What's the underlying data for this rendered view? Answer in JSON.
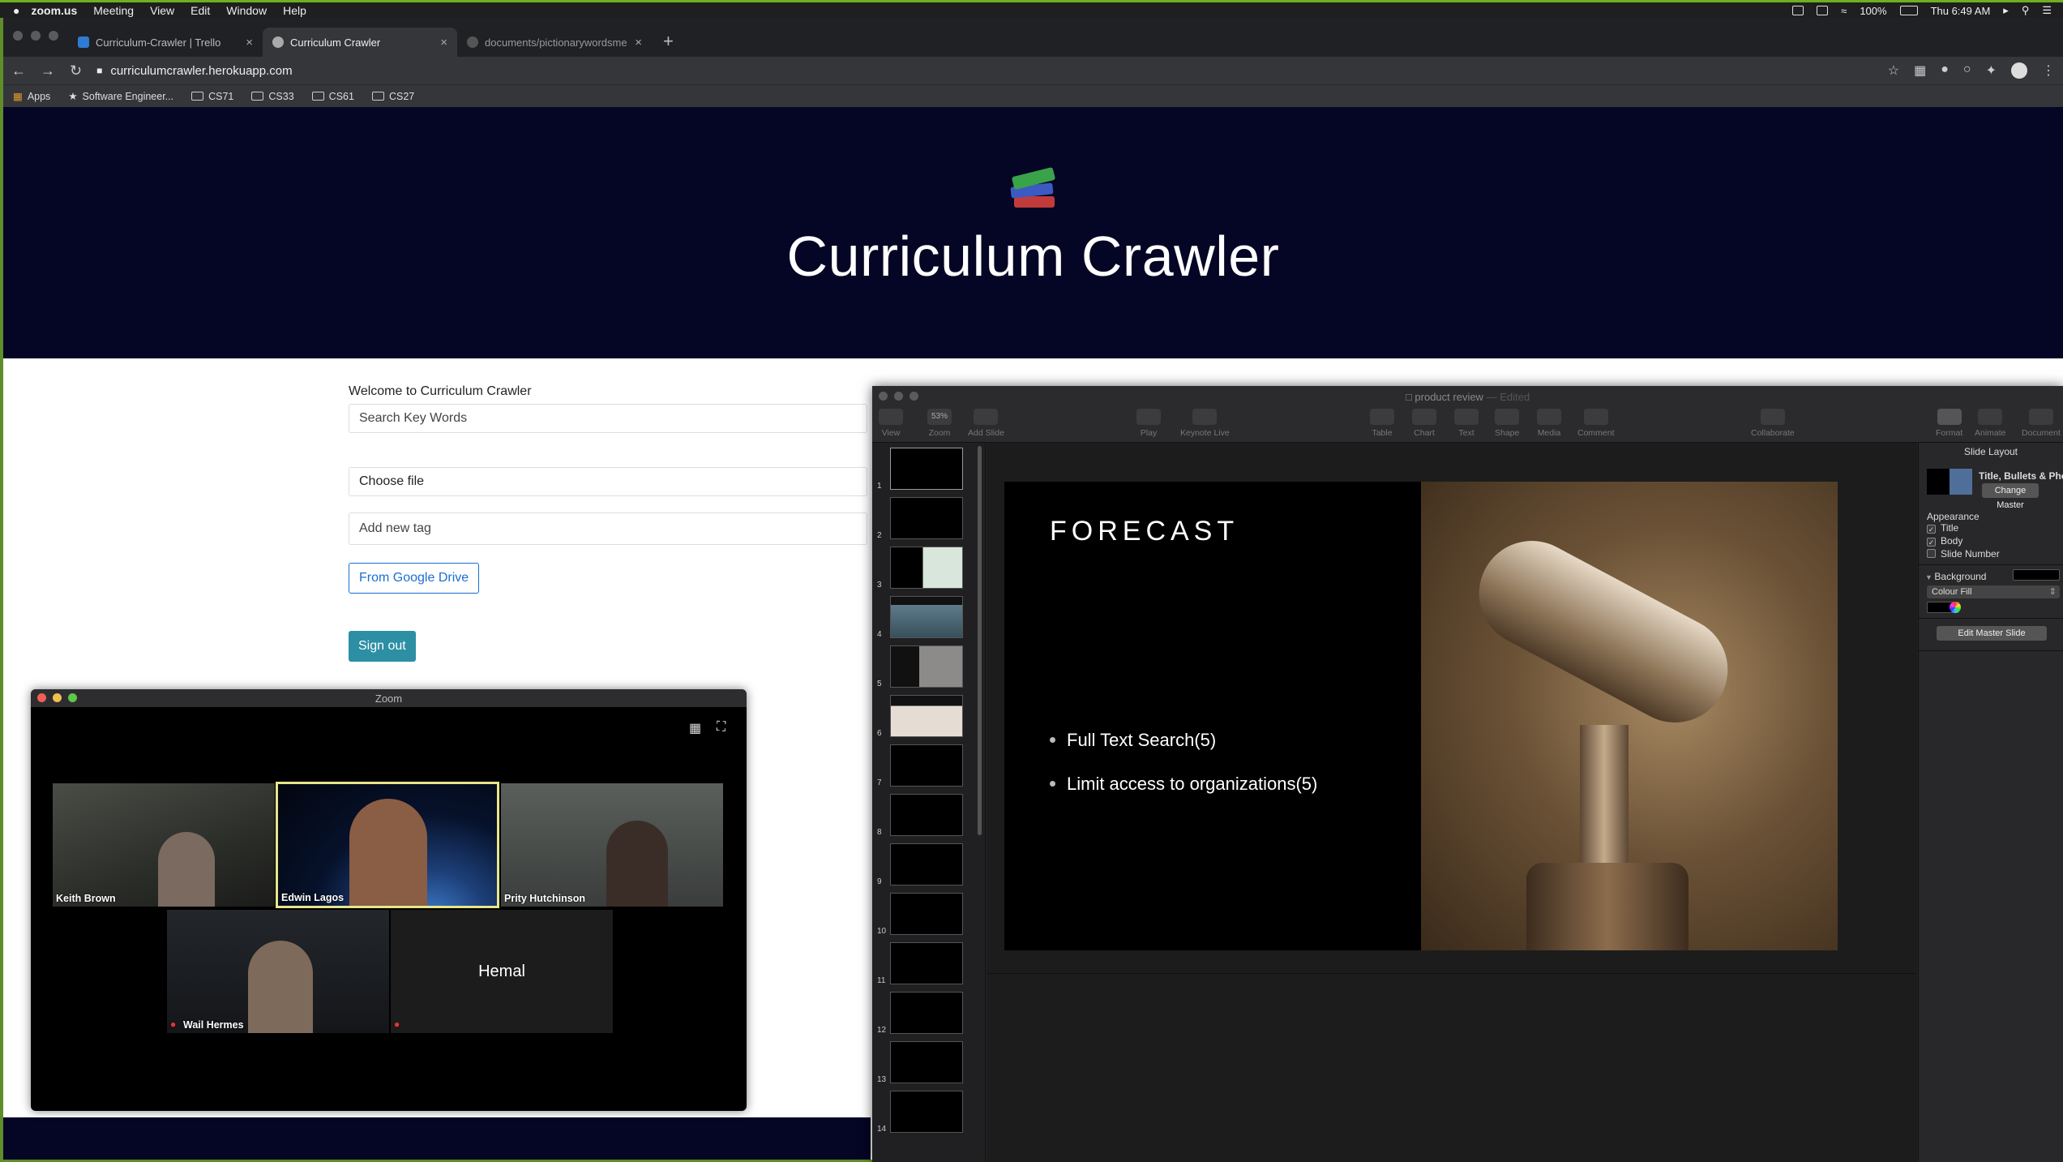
{
  "menubar": {
    "app": "zoom.us",
    "items": [
      "Meeting",
      "View",
      "Edit",
      "Window",
      "Help"
    ],
    "battery": "100%",
    "clock": "Thu 6:49 AM"
  },
  "browser": {
    "tabs": [
      {
        "label": "Curriculum-Crawler | Trello"
      },
      {
        "label": "Curriculum Crawler"
      },
      {
        "label": "documents/pictionarywordsme"
      }
    ],
    "url": "curriculumcrawler.herokuapp.com",
    "bookmarks": [
      "Apps",
      "Software Engineer...",
      "CS71",
      "CS33",
      "CS61",
      "CS27"
    ]
  },
  "site": {
    "title": "Curriculum Crawler",
    "welcome": "Welcome to Curriculum Crawler",
    "search_placeholder": "Search Key Words",
    "choose_file": "Choose file",
    "tag_placeholder": "Add new tag",
    "drive_button": "From Google Drive",
    "signout_button": "Sign out"
  },
  "zoom": {
    "window_title": "Zoom",
    "participants": [
      {
        "name": "Keith Brown"
      },
      {
        "name": "Edwin Lagos"
      },
      {
        "name": "Prity Hutchinson"
      },
      {
        "name": "Wail Hermes"
      },
      {
        "name": "Hemal"
      }
    ]
  },
  "keynote": {
    "doc_title": "product review",
    "doc_state": "— Edited",
    "zoom_value": "53%",
    "toolbar": [
      "View",
      "Zoom",
      "Add Slide",
      "Play",
      "Keynote Live",
      "Table",
      "Chart",
      "Text",
      "Shape",
      "Media",
      "Comment",
      "Collaborate",
      "Format",
      "Animate",
      "Document"
    ],
    "slide_numbers": [
      "1",
      "2",
      "3",
      "4",
      "5",
      "6",
      "7",
      "8",
      "9",
      "10",
      "11",
      "12",
      "13",
      "14"
    ],
    "slide": {
      "title": "FORECAST",
      "bullets": [
        "Full Text Search(5)",
        "Limit access to organizations(5)"
      ]
    },
    "inspector": {
      "header": "Slide Layout",
      "layout_name": "Title, Bullets & Photo",
      "change_master": "Change Master",
      "appearance": "Appearance",
      "opt_title": "Title",
      "opt_body": "Body",
      "opt_slide_number": "Slide Number",
      "background": "Background",
      "fill": "Colour Fill",
      "edit_master": "Edit Master Slide"
    }
  },
  "colors": {
    "hero_bg": "#050525",
    "accent_blue": "#1a6fd1",
    "signout_teal": "#2c8fa4",
    "active_speaker": "#e8e58a"
  }
}
